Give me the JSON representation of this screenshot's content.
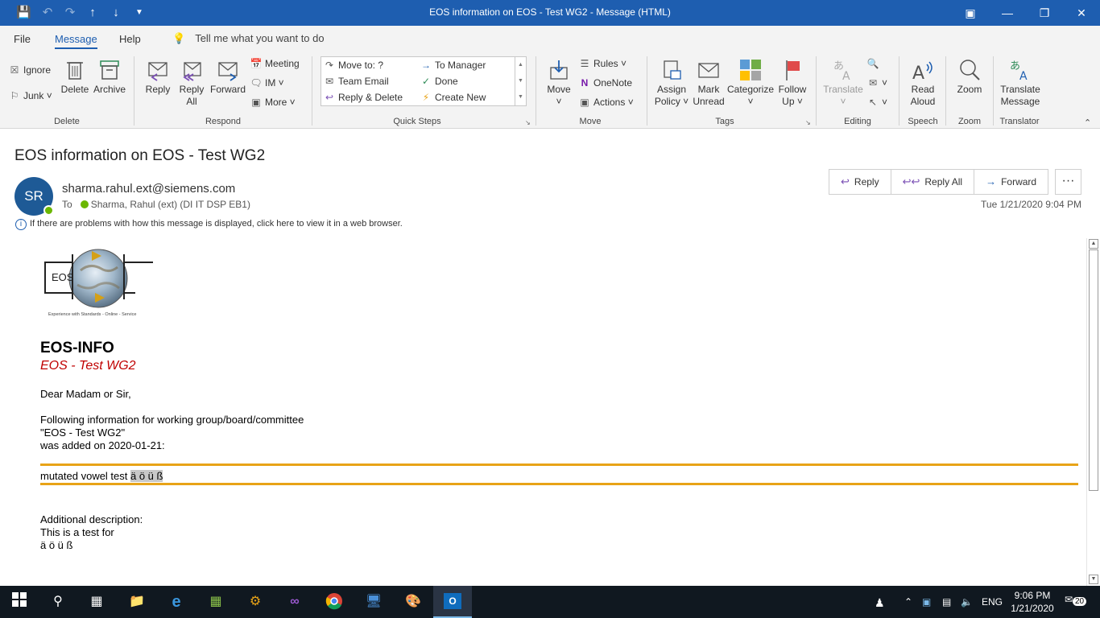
{
  "window": {
    "title": "EOS information on EOS - Test WG2  -  Message (HTML)"
  },
  "menu": {
    "items": [
      "File",
      "Message",
      "Help"
    ],
    "active": "Message",
    "tellme": "Tell me what you want to do"
  },
  "ribbon": {
    "delete_group": {
      "label": "Delete",
      "ignore": "Ignore",
      "junk": "Junk",
      "delete": "Delete",
      "archive": "Archive"
    },
    "respond_group": {
      "label": "Respond",
      "reply": "Reply",
      "reply_all_1": "Reply",
      "reply_all_2": "All",
      "forward": "Forward",
      "meeting": "Meeting",
      "im": "IM",
      "more": "More"
    },
    "quicksteps_group": {
      "label": "Quick Steps",
      "move_to": "Move to: ?",
      "team_email": "Team Email",
      "reply_delete": "Reply & Delete",
      "to_manager": "To Manager",
      "done": "Done",
      "create_new": "Create New"
    },
    "move_group": {
      "label": "Move",
      "move": "Move",
      "rules": "Rules",
      "onenote": "OneNote",
      "actions": "Actions"
    },
    "tags_group": {
      "label": "Tags",
      "assign_1": "Assign",
      "assign_2": "Policy",
      "mark_1": "Mark",
      "mark_2": "Unread",
      "categorize": "Categorize",
      "follow_1": "Follow",
      "follow_2": "Up"
    },
    "editing_group": {
      "label": "Editing",
      "translate": "Translate"
    },
    "speech_group": {
      "label": "Speech",
      "read_1": "Read",
      "read_2": "Aloud"
    },
    "zoom_group": {
      "label": "Zoom",
      "zoom": "Zoom"
    },
    "translator_group": {
      "label": "Translator",
      "tm_1": "Translate",
      "tm_2": "Message"
    }
  },
  "message": {
    "subject": "EOS information on EOS - Test WG2",
    "avatar_initials": "SR",
    "sender": "sharma.rahul.ext@siemens.com",
    "to_label": "To",
    "recipient": "Sharma, Rahul (ext) (DI IT DSP EB1)",
    "date": "Tue 1/21/2020 9:04 PM",
    "info_bar": "If there are problems with how this message is displayed, click here to view it in a web browser.",
    "actions": {
      "reply": "Reply",
      "reply_all": "Reply All",
      "forward": "Forward",
      "more": "···"
    }
  },
  "body": {
    "logo_text": "EOS",
    "logo_caption": "Experience with Standards - Online - Service",
    "heading": "EOS-INFO",
    "subheading": "EOS - Test WG2",
    "greeting": "Dear Madam or Sir,",
    "line1": "Following information for working group/board/committee",
    "line2": "\"EOS - Test WG2\"",
    "line3": "was added on 2020-01-21:",
    "vowel_prefix": "mutated vowel test ",
    "vowel_selected": "ä ö ü ß",
    "add_label": "Additional description:",
    "add_line1": "This is a test for",
    "add_line2": "ä ö ü ß"
  },
  "taskbar": {
    "lang": "ENG",
    "time": "9:06 PM",
    "date": "1/21/2020",
    "notifications": "20"
  },
  "colors": {
    "title_bar": "#1e5eb0",
    "accent_line": "#e8a317",
    "subheading_red": "#c00000",
    "avatar": "#1e5a96"
  }
}
